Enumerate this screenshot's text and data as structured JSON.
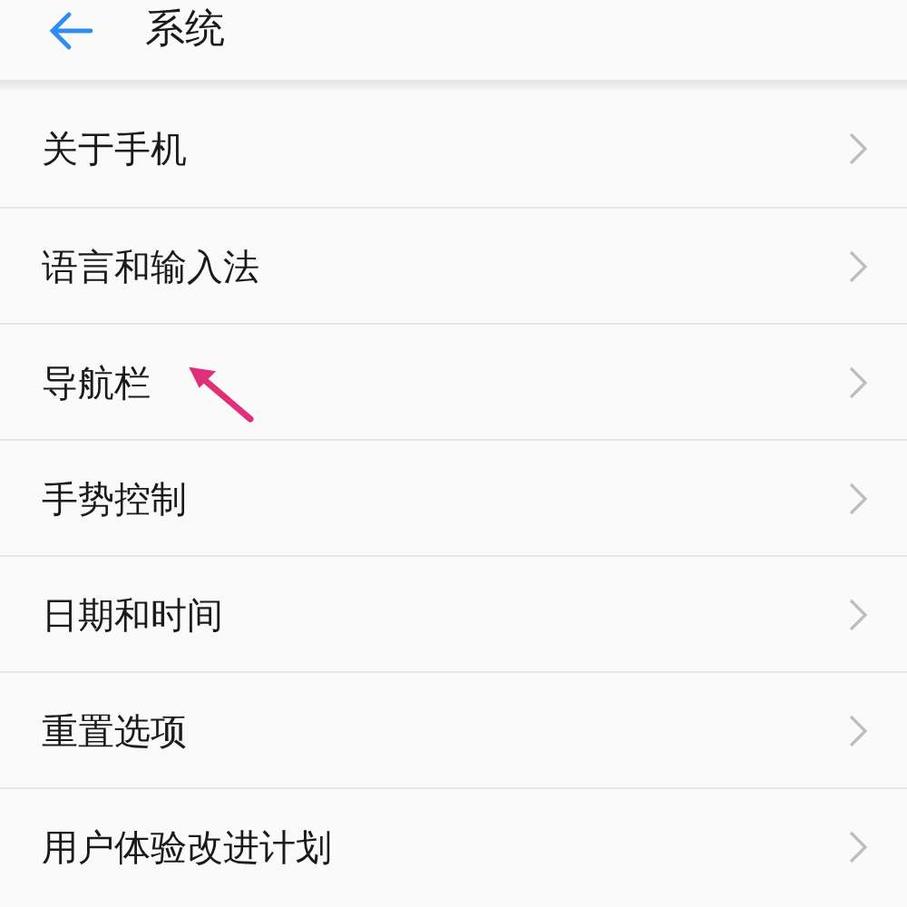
{
  "header": {
    "title": "系统"
  },
  "items": [
    {
      "label": "关于手机",
      "pointed": false
    },
    {
      "label": "语言和输入法",
      "pointed": false
    },
    {
      "label": "导航栏",
      "pointed": true
    },
    {
      "label": "手势控制",
      "pointed": false
    },
    {
      "label": "日期和时间",
      "pointed": false
    },
    {
      "label": "重置选项",
      "pointed": false
    },
    {
      "label": "用户体验改进计划",
      "pointed": false
    }
  ]
}
